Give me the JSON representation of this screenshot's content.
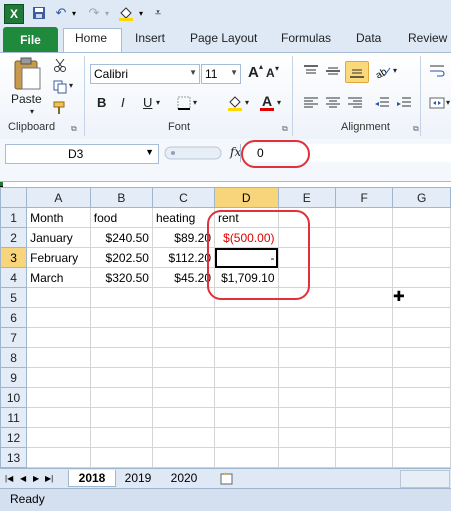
{
  "qat": {
    "undo_icon": "undo-icon",
    "redo_icon": "redo-icon",
    "save_icon": "save-icon"
  },
  "tabs": [
    "File",
    "Home",
    "Insert",
    "Page Layout",
    "Formulas",
    "Data",
    "Review"
  ],
  "ribbon": {
    "paste_label": "Paste",
    "font_name": "Calibri",
    "font_size": "11",
    "bold": "B",
    "italic": "I",
    "underline": "U",
    "font_color_letter": "A",
    "grow_font": "A",
    "shrink_font": "A",
    "groups": {
      "clipboard": "Clipboard",
      "font": "Font",
      "alignment": "Alignment"
    }
  },
  "formula_bar": {
    "name_box": "D3",
    "fx_label": "fx",
    "formula": "0"
  },
  "grid": {
    "columns": [
      "A",
      "B",
      "C",
      "D",
      "E",
      "F",
      "G"
    ],
    "rows": [
      {
        "num": "1",
        "cells": [
          "Month",
          "food",
          "heating",
          "rent",
          "",
          "",
          ""
        ]
      },
      {
        "num": "2",
        "cells": [
          "January",
          "$240.50",
          "$89.20",
          "$(500.00)",
          "",
          "",
          ""
        ]
      },
      {
        "num": "3",
        "cells": [
          "February",
          "$202.50",
          "$112.20",
          "-",
          "",
          "",
          ""
        ]
      },
      {
        "num": "4",
        "cells": [
          "March",
          "$320.50",
          "$45.20",
          "$1,709.10",
          "",
          "",
          ""
        ]
      },
      {
        "num": "5",
        "cells": [
          "",
          "",
          "",
          "",
          "",
          "",
          ""
        ]
      },
      {
        "num": "6",
        "cells": [
          "",
          "",
          "",
          "",
          "",
          "",
          ""
        ]
      },
      {
        "num": "7",
        "cells": [
          "",
          "",
          "",
          "",
          "",
          "",
          ""
        ]
      },
      {
        "num": "8",
        "cells": [
          "",
          "",
          "",
          "",
          "",
          "",
          ""
        ]
      },
      {
        "num": "9",
        "cells": [
          "",
          "",
          "",
          "",
          "",
          "",
          ""
        ]
      },
      {
        "num": "10",
        "cells": [
          "",
          "",
          "",
          "",
          "",
          "",
          ""
        ]
      },
      {
        "num": "11",
        "cells": [
          "",
          "",
          "",
          "",
          "",
          "",
          ""
        ]
      },
      {
        "num": "12",
        "cells": [
          "",
          "",
          "",
          "",
          "",
          "",
          ""
        ]
      },
      {
        "num": "13",
        "cells": [
          "",
          "",
          "",
          "",
          "",
          "",
          ""
        ]
      }
    ],
    "selected_cell": "D3",
    "negative_color": "#e00000"
  },
  "sheets": [
    "2018",
    "2019",
    "2020"
  ],
  "active_sheet": "2018",
  "status": "Ready"
}
